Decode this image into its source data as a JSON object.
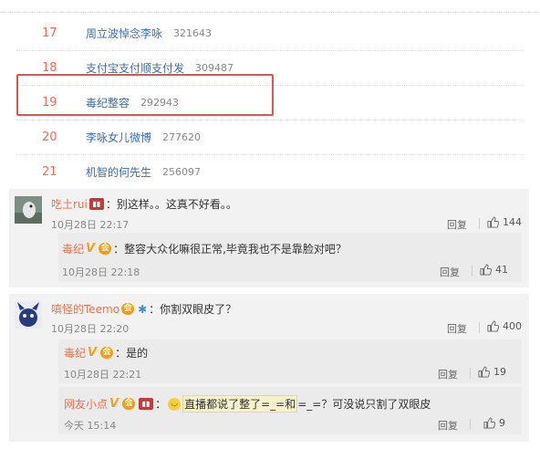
{
  "trends": [
    {
      "rank": "17",
      "title": "周立波悼念李咏",
      "count": "321643"
    },
    {
      "rank": "18",
      "title": "支付宝支付顺支付发",
      "count": "309487"
    },
    {
      "rank": "19",
      "title": "毒纪整容",
      "count": "292943"
    },
    {
      "rank": "20",
      "title": "李咏女儿微博",
      "count": "277620"
    },
    {
      "rank": "21",
      "title": "机智的何先生",
      "count": "256097"
    }
  ],
  "comments": [
    {
      "author": "吃土rui",
      "text": "：别这样。。这真不好看。。",
      "time": "10月28日 22:17",
      "reply_label": "回复",
      "likes": "144",
      "reply": {
        "author": "毒纪",
        "text": "：整容大众化嘛很正常,毕竟我也不是靠脸对吧？",
        "time": "10月28日 22:18",
        "reply_label": "回复",
        "likes": "41"
      }
    },
    {
      "author": "嗔怪的Teemo",
      "text": "：你割双眼皮了？",
      "time": "10月28日 22:20",
      "reply_label": "回复",
      "likes": "400",
      "replies": [
        {
          "author": "毒纪",
          "text": "：是的",
          "time": "10月28日 22:21",
          "reply_label": "回复",
          "likes": "19"
        },
        {
          "author": "网友小点",
          "text_prefix": "：",
          "text_quoted": "直播都说了整了=_=和",
          "text_mid": "=_=？可没说只割了双眼皮",
          "time": "今天 15:14",
          "reply_label": "回复",
          "likes": "9"
        }
      ]
    }
  ],
  "icons": {
    "vip": "vip-icon",
    "member": "member-icon",
    "badge": "badge-icon",
    "like": "thumbs-up-icon"
  },
  "colors": {
    "author": "#eb7350",
    "rank": "#f26b5b",
    "link": "#3b6ea5",
    "highlight": "#e25454"
  }
}
